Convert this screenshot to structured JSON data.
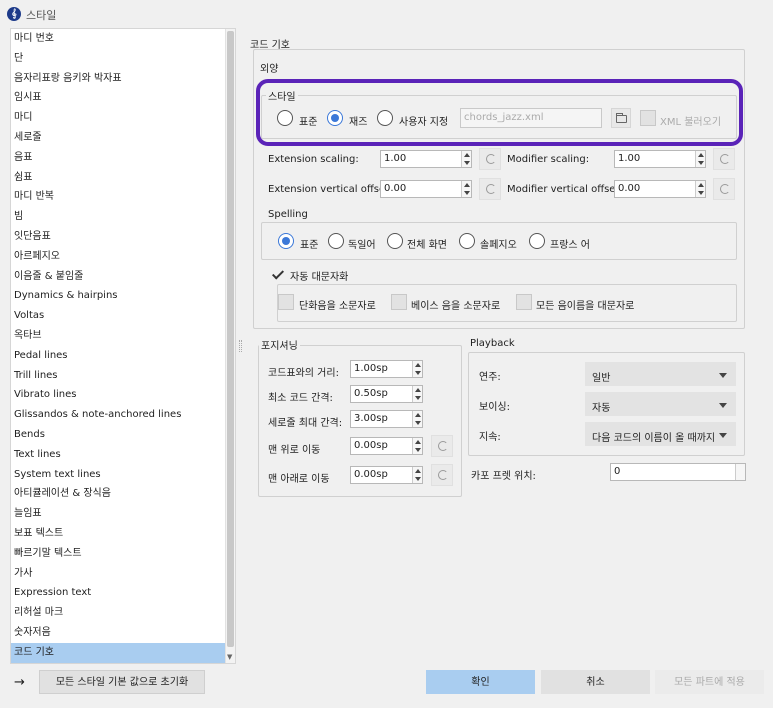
{
  "window": {
    "icon_glyph": "𝄞",
    "title": "스타일"
  },
  "sidebar": {
    "items": [
      {
        "label": "마디 번호"
      },
      {
        "label": "단"
      },
      {
        "label": "음자리표랑 음키와 박자표"
      },
      {
        "label": "임시표"
      },
      {
        "label": "마디"
      },
      {
        "label": "세로줄"
      },
      {
        "label": "음표"
      },
      {
        "label": "쉼표"
      },
      {
        "label": "마디 반복"
      },
      {
        "label": "빔"
      },
      {
        "label": "잇단음표"
      },
      {
        "label": "아르페지오"
      },
      {
        "label": "이음줄 & 붙임줄"
      },
      {
        "label": "Dynamics & hairpins"
      },
      {
        "label": "Voltas"
      },
      {
        "label": "옥타브"
      },
      {
        "label": "Pedal lines"
      },
      {
        "label": "Trill lines"
      },
      {
        "label": "Vibrato lines"
      },
      {
        "label": "Glissandos & note-anchored lines"
      },
      {
        "label": "Bends"
      },
      {
        "label": "Text lines"
      },
      {
        "label": "System text lines"
      },
      {
        "label": "아티큘레이션 & 장식음"
      },
      {
        "label": "늘임표"
      },
      {
        "label": "보표 텍스트"
      },
      {
        "label": "빠르기말 텍스트"
      },
      {
        "label": "가사"
      },
      {
        "label": "Expression text"
      },
      {
        "label": "리허설 마크"
      },
      {
        "label": "숫자저음"
      },
      {
        "label": "코드 기호"
      }
    ],
    "selected_index": 31
  },
  "main": {
    "heading": "코드 기호",
    "appearance": {
      "title": "외양",
      "style": {
        "title": "스타일",
        "options": [
          "표준",
          "재즈",
          "사용자 지정"
        ],
        "selected": 1,
        "file_value": "chords_jazz.xml",
        "folder_icon": "folder-icon",
        "load_xml_label": "XML 불러오기"
      },
      "extension_scaling": {
        "label": "Extension scaling:",
        "value": "1.00"
      },
      "modifier_scaling": {
        "label": "Modifier scaling:",
        "value": "1.00"
      },
      "extension_offset": {
        "label": "Extension vertical offset:",
        "value": "0.00"
      },
      "modifier_offset": {
        "label": "Modifier vertical offset:",
        "value": "0.00"
      },
      "reset_icon": "reset-icon",
      "spelling": {
        "title": "Spelling",
        "options": [
          "표준",
          "독일어",
          "전체 화면",
          "솔페지오",
          "프랑스 어"
        ],
        "selected": 0
      },
      "auto_capitalize": {
        "label": "자동 대문자화",
        "checked": true
      },
      "lowercase_minor": {
        "label": "단화음을 소문자로",
        "checked": false
      },
      "lowercase_bass": {
        "label": "베이스 음을 소문자로",
        "checked": false
      },
      "all_caps": {
        "label": "모든 음이름을 대문자로",
        "checked": false
      }
    },
    "positioning": {
      "title": "포지셔닝",
      "rows": [
        {
          "label": "코드표와의 거리:",
          "value": "1.00sp"
        },
        {
          "label": "최소 코드 간격:",
          "value": "0.50sp"
        },
        {
          "label": "세로줄 최대 간격:",
          "value": "3.00sp"
        },
        {
          "label": "맨 위로 이동",
          "value": "0.00sp"
        },
        {
          "label": "맨 아래로 이동",
          "value": "0.00sp"
        }
      ]
    },
    "playback": {
      "title": "Playback",
      "rows": [
        {
          "label": "연주:",
          "value": "일반"
        },
        {
          "label": "보이싱:",
          "value": "자동"
        },
        {
          "label": "지속:",
          "value": "다음 코드의 이름이 올 때까지"
        }
      ]
    },
    "capo": {
      "label": "카포 프렛 위치:",
      "value": "0"
    }
  },
  "footer": {
    "reset_all_label": "모든 스타일 기본 값으로 초기화",
    "ok_label": "확인",
    "cancel_label": "취소",
    "apply_all_label": "모든 파트에 적용",
    "arrow_glyph": "→"
  },
  "colors": {
    "highlight": "#5a23b8",
    "selected": "#a9cdf0",
    "radio": "#3b78d8"
  }
}
